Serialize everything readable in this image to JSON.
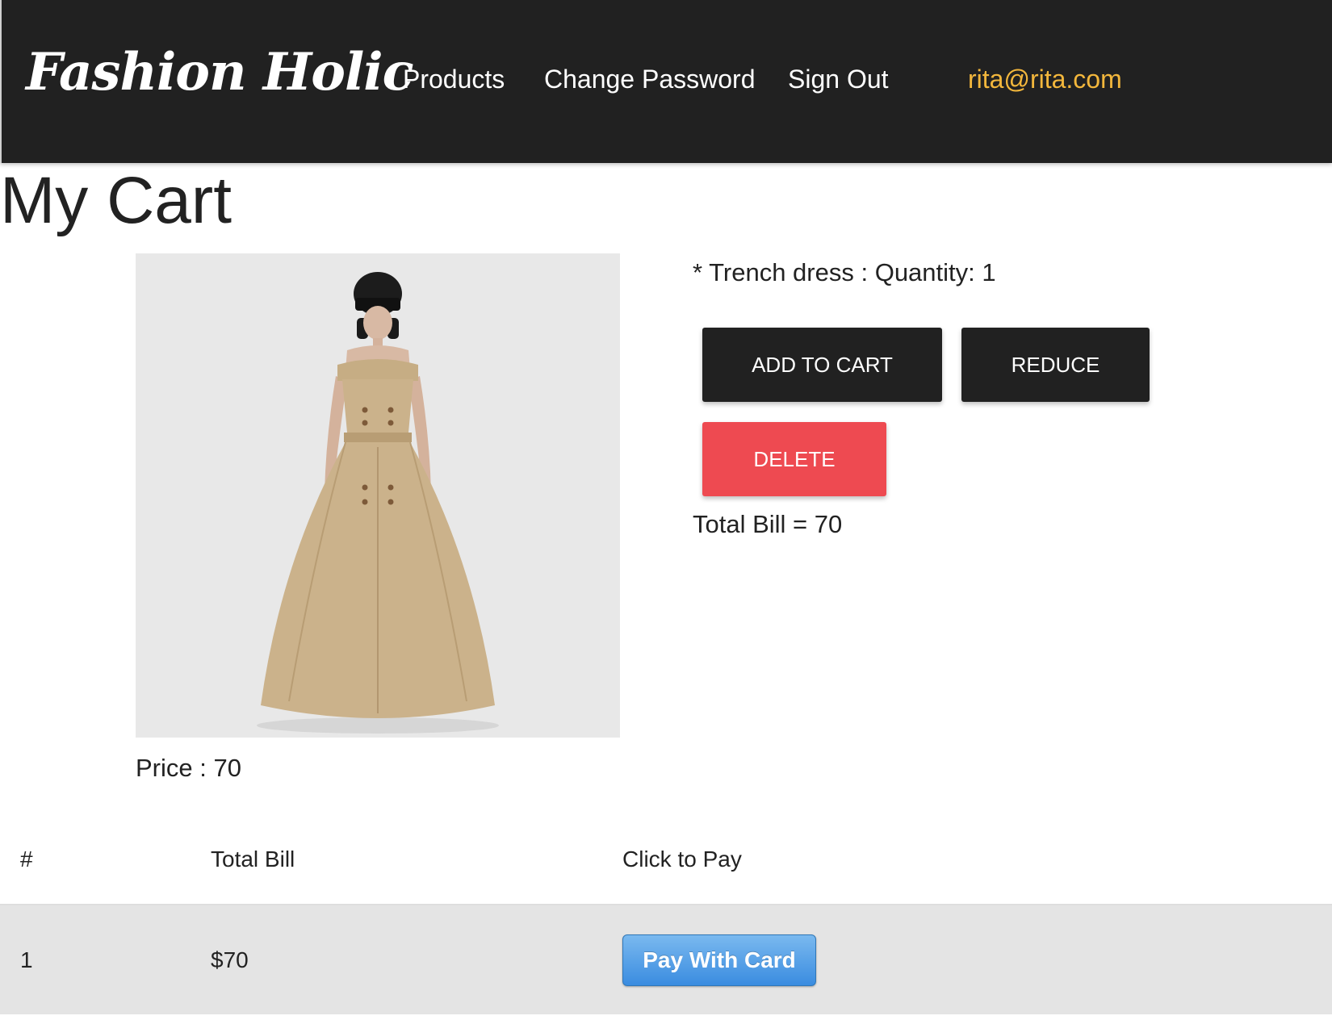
{
  "nav": {
    "brand": "Fashion Holic",
    "links": [
      "Products",
      "Change Password",
      "Sign Out"
    ],
    "user_email": "rita@rita.com",
    "colors": {
      "background": "#212121",
      "user_accent": "#f3b73c"
    }
  },
  "page": {
    "title": "My Cart"
  },
  "cart_item": {
    "description": "* Trench dress : Quantity: 1",
    "price_label": "Price : 70",
    "image_alt": "Trench dress",
    "buttons": {
      "add": "ADD TO CART",
      "reduce": "REDUCE",
      "delete": "DELETE"
    },
    "colors": {
      "dark_button": "#212121",
      "delete_button": "#ee4a51"
    }
  },
  "total_line": "Total Bill = 70",
  "bill_table": {
    "headers": [
      "#",
      "Total Bill",
      "Click to Pay"
    ],
    "rows": [
      {
        "index": "1",
        "total": "$70",
        "pay_label": "Pay With Card"
      }
    ]
  }
}
